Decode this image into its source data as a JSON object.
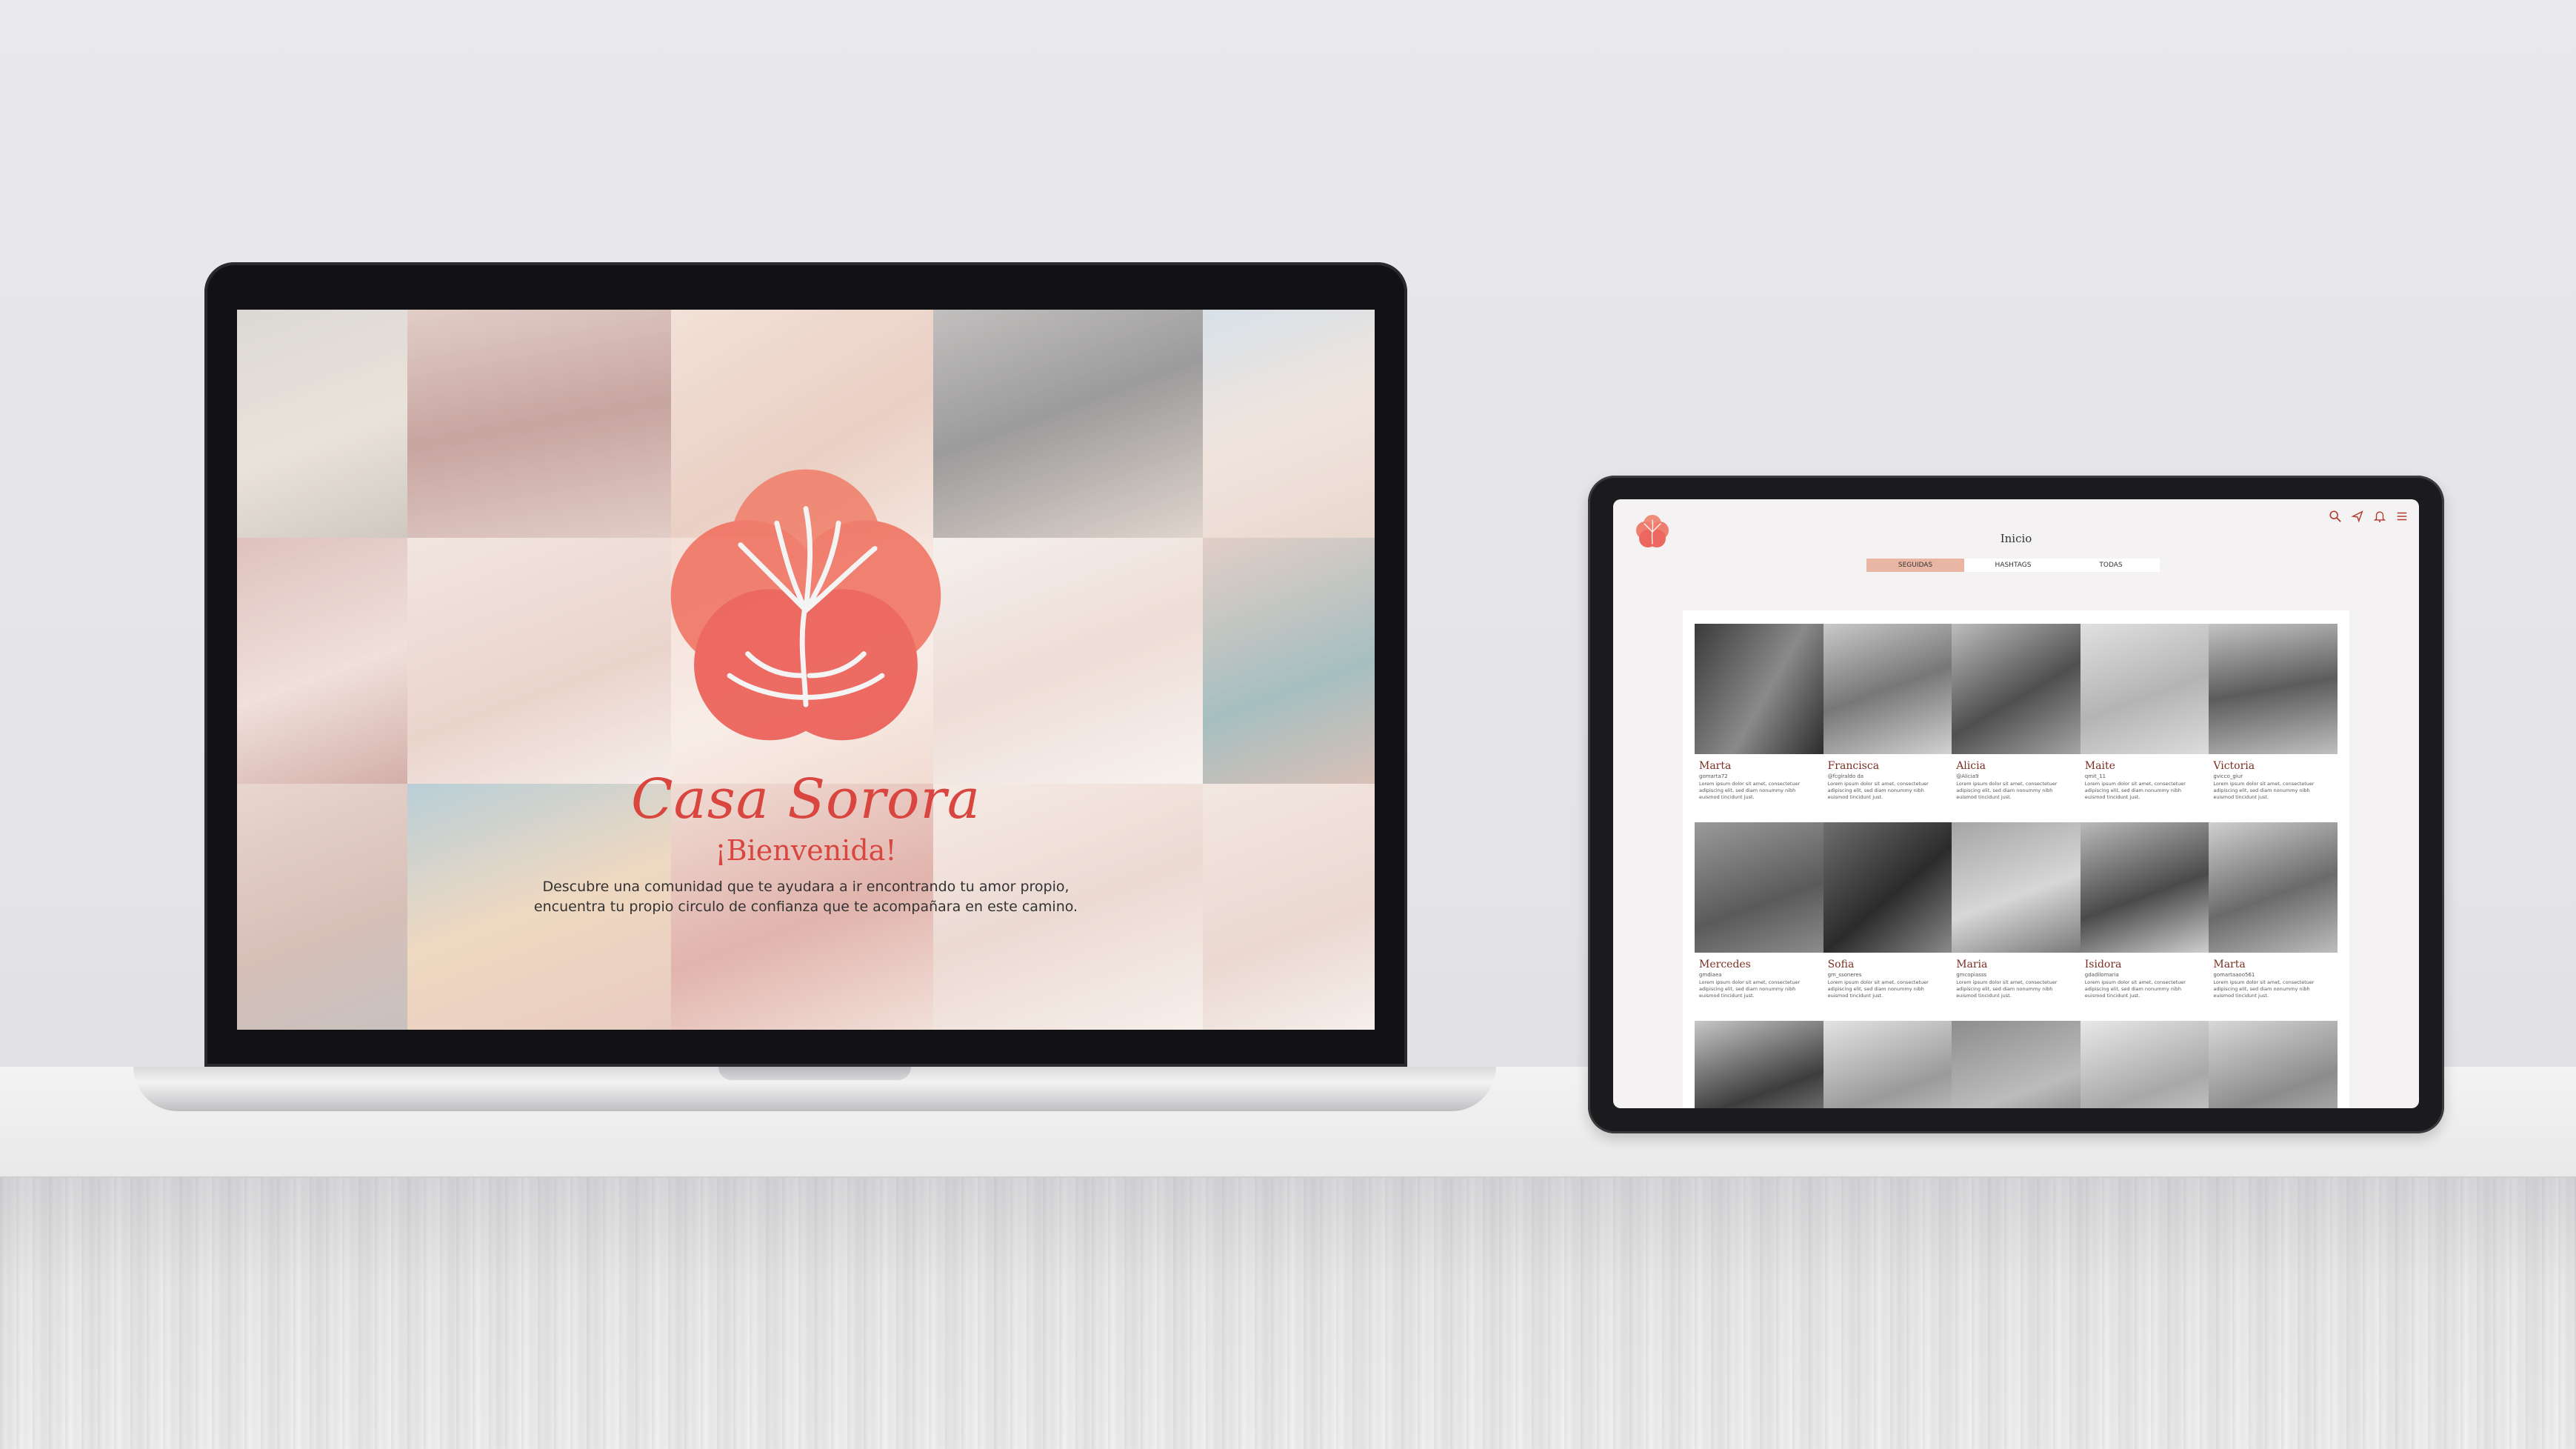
{
  "laptop": {
    "brand_title": "Casa Sorora",
    "welcome": "¡Bienvenida!",
    "description_line1": "Descubre una comunidad que te ayudara a ir encontrando tu amor propio,",
    "description_line2": "encuentra tu propio circulo de confianza que te acompañara en este camino."
  },
  "tablet": {
    "page_title": "Inicio",
    "tabs": [
      {
        "label": "SEGUIDAS",
        "active": true
      },
      {
        "label": "HASHTAGS",
        "active": false
      },
      {
        "label": "TODAS",
        "active": false
      }
    ],
    "icons": [
      "search-icon",
      "share-icon",
      "bell-icon",
      "menu-icon"
    ],
    "cards": [
      {
        "name": "Marta",
        "handle": "gomarta72",
        "text": "Lorem ipsum dolor sit amet, consectetuer adipiscing elit, sed diam nonummy nibh euismod tincidunt just."
      },
      {
        "name": "Francisca",
        "handle": "@fcgiraldo da",
        "text": "Lorem ipsum dolor sit amet, consectetuer adipiscing elit, sed diam nonummy nibh euismod tincidunt just."
      },
      {
        "name": "Alicia",
        "handle": "@Alicia9",
        "text": "Lorem ipsum dolor sit amet, consectetuer adipiscing elit, sed diam nonummy nibh euismod tincidunt just."
      },
      {
        "name": "Maite",
        "handle": "qmit_11",
        "text": "Lorem ipsum dolor sit amet, consectetuer adipiscing elit, sed diam nonummy nibh euismod tincidunt just."
      },
      {
        "name": "Victoria",
        "handle": "gvicco_giur",
        "text": "Lorem ipsum dolor sit amet, consectetuer adipiscing elit, sed diam nonummy nibh euismod tincidunt just."
      },
      {
        "name": "Mercedes",
        "handle": "gmdiaea",
        "text": "Lorem ipsum dolor sit amet, consectetuer adipiscing elit, sed diam nonummy nibh euismod tincidunt just."
      },
      {
        "name": "Sofia",
        "handle": "gm_ssoneres",
        "text": "Lorem ipsum dolor sit amet, consectetuer adipiscing elit, sed diam nonummy nibh euismod tincidunt just."
      },
      {
        "name": "Maria",
        "handle": "gmcopiasss",
        "text": "Lorem ipsum dolor sit amet, consectetuer adipiscing elit, sed diam nonummy nibh euismod tincidunt just."
      },
      {
        "name": "Isidora",
        "handle": "gdadilomaria",
        "text": "Lorem ipsum dolor sit amet, consectetuer adipiscing elit, sed diam nonummy nibh euismod tincidunt just."
      },
      {
        "name": "Marta",
        "handle": "gomartaaoo561",
        "text": "Lorem ipsum dolor sit amet, consectetuer adipiscing elit, sed diam nonummy nibh euismod tincidunt just."
      },
      {
        "name": "",
        "handle": "",
        "text": ""
      },
      {
        "name": "",
        "handle": "",
        "text": ""
      },
      {
        "name": "",
        "handle": "",
        "text": ""
      },
      {
        "name": "",
        "handle": "",
        "text": ""
      },
      {
        "name": "",
        "handle": "",
        "text": ""
      }
    ]
  },
  "colors": {
    "brand_red": "#d9453f",
    "name_brown": "#7a2e22",
    "active_tab": "#e8b6a2"
  }
}
